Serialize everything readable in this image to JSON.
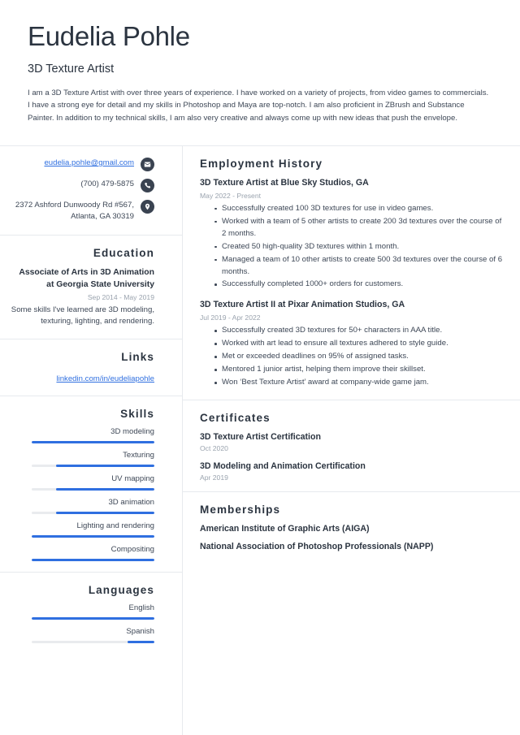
{
  "header": {
    "name": "Eudelia Pohle",
    "job_title": "3D Texture Artist",
    "summary": "I am a 3D Texture Artist with over three years of experience. I have worked on a variety of projects, from video games to commercials. I have a strong eye for detail and my skills in Photoshop and Maya are top-notch. I am also proficient in ZBrush and Substance Painter. In addition to my technical skills, I am also very creative and always come up with new ideas that push the envelope."
  },
  "accent_color": "#2f6fe0",
  "heading_color": "#2b3440",
  "contact": {
    "email": "eudelia.pohle@gmail.com",
    "phone": "(700) 479-5875",
    "address": "2372 Ashford Dunwoody Rd #567, Atlanta, GA 30319",
    "email_icon": "envelope-icon",
    "phone_icon": "phone-icon",
    "address_icon": "location-pin-icon"
  },
  "education": {
    "heading": "Education",
    "degree": "Associate of Arts in 3D Animation at Georgia State University",
    "date": "Sep 2014 - May 2019",
    "description": "Some skills I've learned are 3D modeling, texturing, lighting, and rendering."
  },
  "links": {
    "heading": "Links",
    "items": [
      {
        "label": "linkedin.com/in/eudeliapohle"
      }
    ]
  },
  "skills": {
    "heading": "Skills",
    "items": [
      {
        "label": "3D modeling",
        "level": 100
      },
      {
        "label": "Texturing",
        "level": 80
      },
      {
        "label": "UV mapping",
        "level": 80
      },
      {
        "label": "3D animation",
        "level": 80
      },
      {
        "label": "Lighting and rendering",
        "level": 100
      },
      {
        "label": "Compositing",
        "level": 100
      }
    ]
  },
  "languages": {
    "heading": "Languages",
    "items": [
      {
        "label": "English",
        "level": 100
      },
      {
        "label": "Spanish",
        "level": 22
      }
    ]
  },
  "employment": {
    "heading": "Employment History",
    "entries": [
      {
        "title": "3D Texture Artist at Blue Sky Studios, GA",
        "date": "May 2022 - Present",
        "bullets": [
          "Successfully created 100 3D textures for use in video games.",
          "Worked with a team of 5 other artists to create 200 3d textures over the course of 2 months.",
          "Created 50 high-quality 3D textures within 1 month.",
          "Managed a team of 10 other artists to create 500 3d textures over the course of 6 months.",
          "Successfully completed 1000+ orders for customers."
        ]
      },
      {
        "title": "3D Texture Artist II at Pixar Animation Studios, GA",
        "date": "Jul 2019 - Apr 2022",
        "bullets": [
          "Successfully created 3D textures for 50+ characters in AAA title.",
          "Worked with art lead to ensure all textures adhered to style guide.",
          "Met or exceeded deadlines on 95% of assigned tasks.",
          "Mentored 1 junior artist, helping them improve their skillset.",
          "Won ‘Best Texture Artist’ award at company-wide game jam."
        ]
      }
    ]
  },
  "certificates": {
    "heading": "Certificates",
    "items": [
      {
        "name": "3D Texture Artist Certification",
        "date": "Oct 2020"
      },
      {
        "name": "3D Modeling and Animation Certification",
        "date": "Apr 2019"
      }
    ]
  },
  "memberships": {
    "heading": "Memberships",
    "items": [
      {
        "name": "American Institute of Graphic Arts (AIGA)"
      },
      {
        "name": "National Association of Photoshop Professionals (NAPP)"
      }
    ]
  }
}
